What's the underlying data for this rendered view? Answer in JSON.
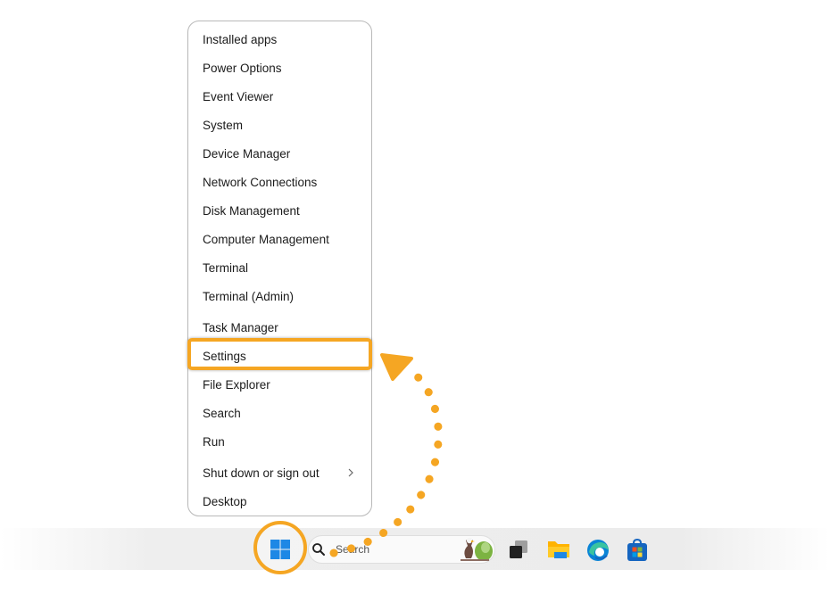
{
  "menu": {
    "items": [
      {
        "label": "Installed apps"
      },
      {
        "label": "Power Options"
      },
      {
        "label": "Event Viewer"
      },
      {
        "label": "System"
      },
      {
        "label": "Device Manager"
      },
      {
        "label": "Network Connections"
      },
      {
        "label": "Disk Management"
      },
      {
        "label": "Computer Management"
      },
      {
        "label": "Terminal"
      },
      {
        "label": "Terminal (Admin)"
      },
      {
        "label": "Task Manager"
      },
      {
        "label": "Settings"
      },
      {
        "label": "File Explorer"
      },
      {
        "label": "Search"
      },
      {
        "label": "Run"
      },
      {
        "label": "Shut down or sign out"
      },
      {
        "label": "Desktop"
      }
    ],
    "highlighted": "Settings"
  },
  "taskbar": {
    "search_placeholder": "Search",
    "icons": [
      "windows-start-icon",
      "search-icon",
      "task-view-icon",
      "file-explorer-icon",
      "edge-icon",
      "microsoft-store-icon"
    ]
  },
  "colors": {
    "accent": "#f5a623",
    "windows_blue": "#1e88e5"
  }
}
